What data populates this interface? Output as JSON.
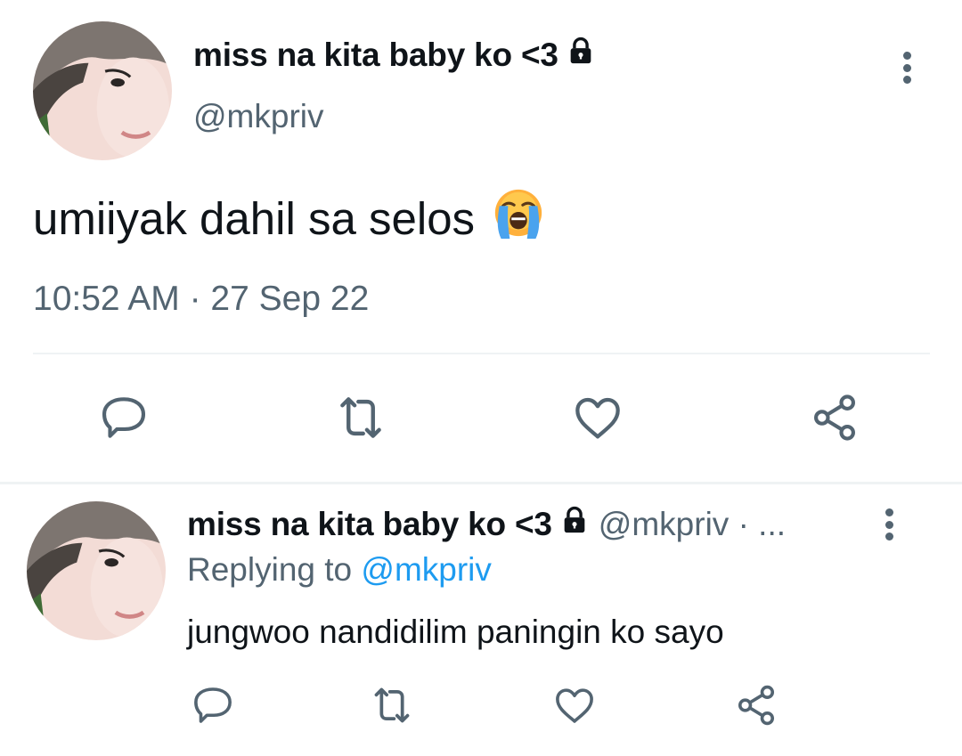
{
  "tweet": {
    "display_name": "miss na kita baby ko <3",
    "handle": "@mkpriv",
    "text": "umiiyak dahil sa selos",
    "emoji": "loudly-crying-face",
    "timestamp": "10:52 AM · 27 Sep 22"
  },
  "reply": {
    "display_name": "miss na kita baby ko <3",
    "handle_meta": "@mkpriv · ...",
    "replying_prefix": "Replying to",
    "replying_mention": "@mkpriv",
    "text": "jungwoo nandidilim paningin ko sayo"
  },
  "icons": {
    "actions": [
      "reply-icon",
      "retweet-icon",
      "like-icon",
      "share-icon"
    ],
    "protected": "lock-icon",
    "more": "more-options-icon"
  },
  "colors": {
    "text": "#0f1419",
    "secondary": "#536471",
    "link": "#1d9bf0",
    "divider": "#eff3f4"
  }
}
